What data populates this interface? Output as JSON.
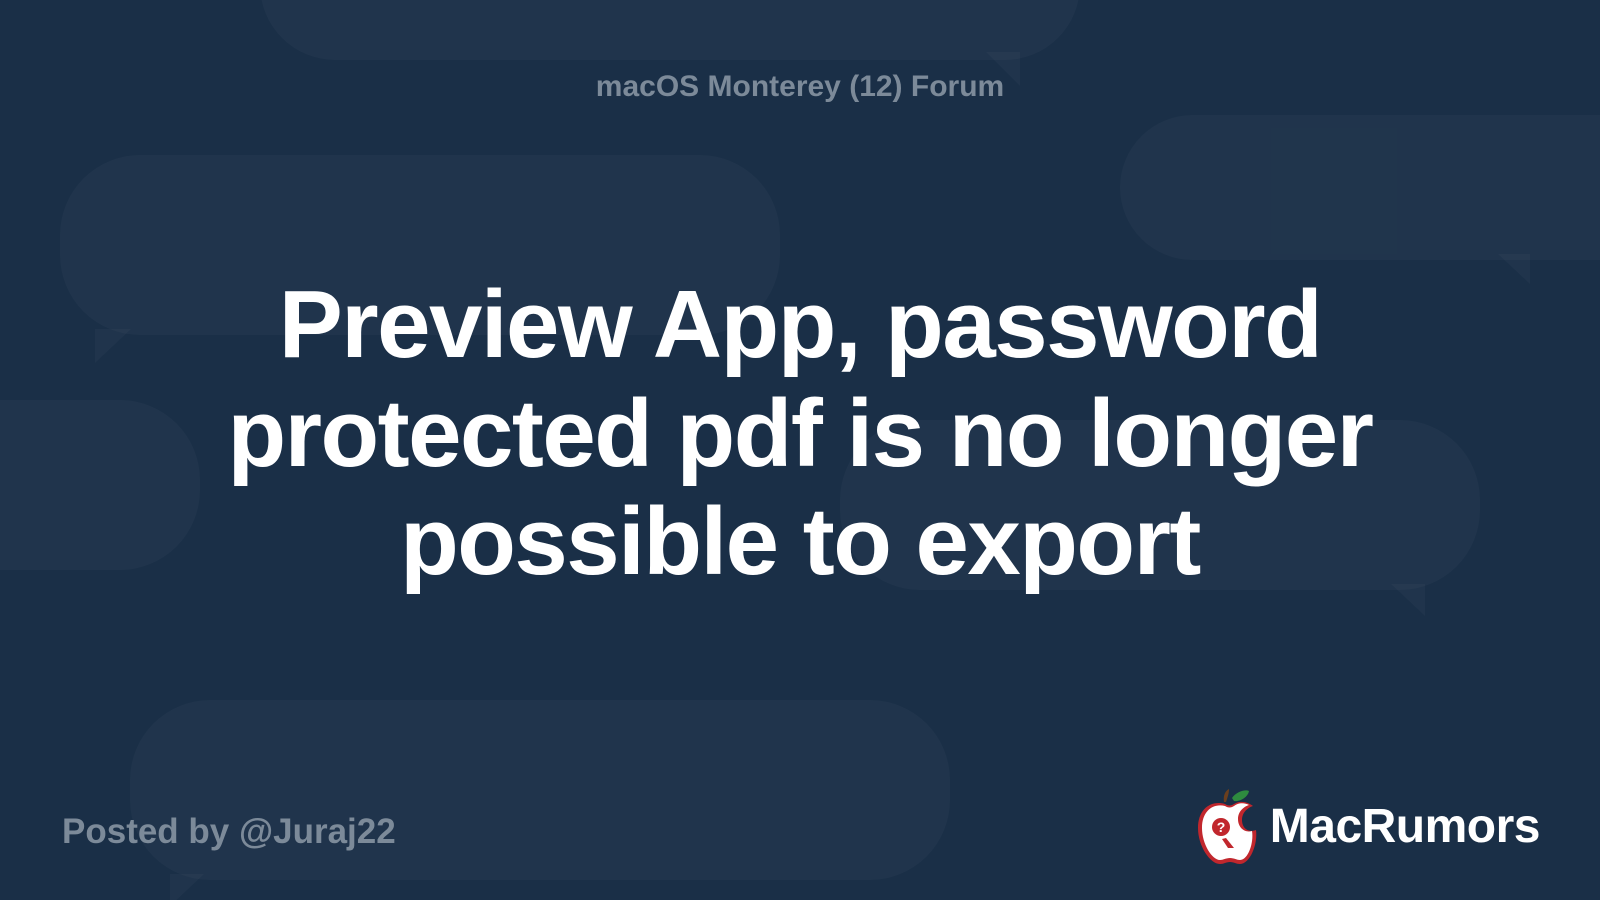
{
  "forum": {
    "name": "macOS Monterey (12) Forum"
  },
  "post": {
    "title": "Preview App, password protected pdf is no longer possible to export",
    "posted_by_label": "Posted by @Juraj22"
  },
  "brand": {
    "name": "MacRumors",
    "colors": {
      "apple_red": "#c1272d",
      "apple_white": "#ffffff",
      "leaf_green": "#2e8b3f",
      "bg_navy": "#1a2f47"
    }
  }
}
